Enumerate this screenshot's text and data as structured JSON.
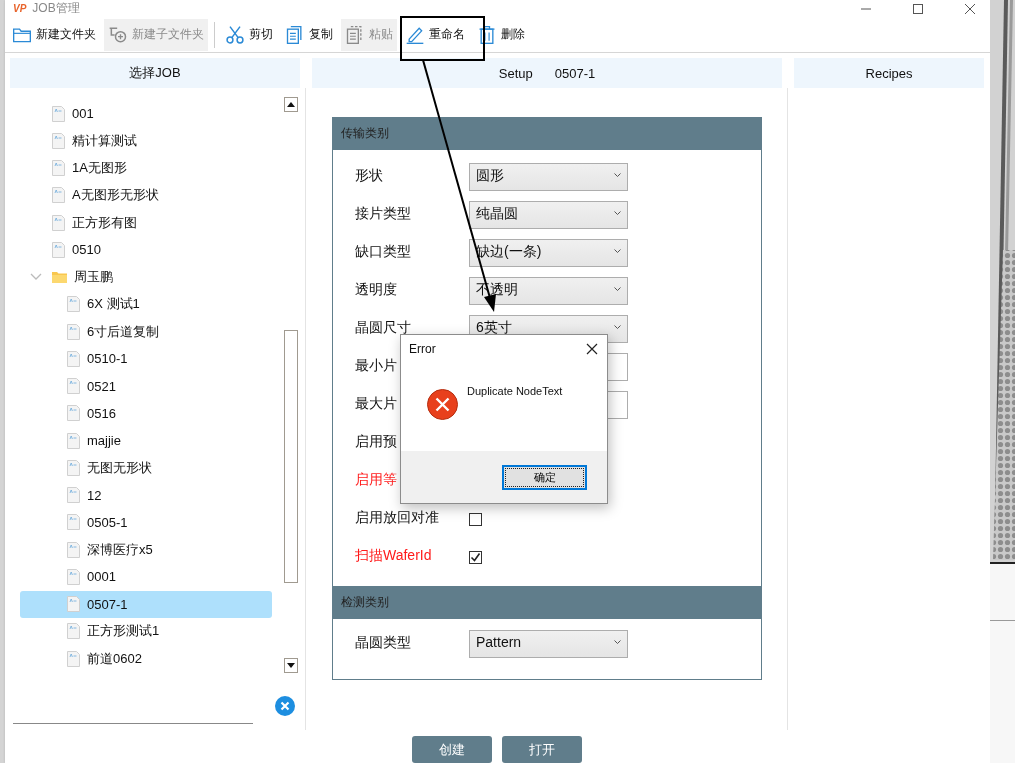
{
  "window": {
    "logo": "VP",
    "title": "JOB管理"
  },
  "toolbar": {
    "groups": [
      [
        {
          "label": "新建文件夹",
          "disabled": false
        },
        {
          "label": "新建子文件夹",
          "disabled": true
        }
      ],
      [
        {
          "label": "剪切",
          "disabled": false
        },
        {
          "label": "复制",
          "disabled": false
        },
        {
          "label": "粘贴",
          "disabled": true
        },
        {
          "label": "重命名",
          "disabled": false
        },
        {
          "label": "删除",
          "disabled": false
        }
      ]
    ]
  },
  "job_panel": {
    "header": "选择JOB",
    "tree": [
      {
        "label": "001",
        "kind": "file",
        "selected": false
      },
      {
        "label": "精计算测试",
        "kind": "file",
        "selected": false
      },
      {
        "label": "1A无图形",
        "kind": "file",
        "selected": false
      },
      {
        "label": "A无图形无形状",
        "kind": "file",
        "selected": false
      },
      {
        "label": "正方形有图",
        "kind": "file",
        "selected": false
      },
      {
        "label": "0510",
        "kind": "file",
        "selected": false
      },
      {
        "label": "周玉鹏",
        "kind": "folder",
        "selected": false,
        "expanded": true,
        "children": [
          {
            "label": "6X 测试1",
            "kind": "file",
            "selected": false
          },
          {
            "label": "6寸后道复制",
            "kind": "file",
            "selected": false
          },
          {
            "label": "0510-1",
            "kind": "file",
            "selected": false
          },
          {
            "label": "0521",
            "kind": "file",
            "selected": false
          },
          {
            "label": "0516",
            "kind": "file",
            "selected": false
          },
          {
            "label": "majjie",
            "kind": "file",
            "selected": false
          },
          {
            "label": "无图无形状",
            "kind": "file",
            "selected": false
          },
          {
            "label": "12",
            "kind": "file",
            "selected": false
          },
          {
            "label": "0505-1",
            "kind": "file",
            "selected": false
          },
          {
            "label": "深博医疗x5",
            "kind": "file",
            "selected": false
          },
          {
            "label": "0001",
            "kind": "file",
            "selected": false
          },
          {
            "label": "0507-1",
            "kind": "file",
            "selected": true
          },
          {
            "label": "正方形测试1",
            "kind": "file",
            "selected": false
          },
          {
            "label": "前道0602",
            "kind": "file",
            "selected": false
          }
        ]
      }
    ]
  },
  "setup_panel": {
    "header_label": "Setup",
    "header_value": "0507-1",
    "sections": [
      {
        "title": "传输类别",
        "rows": [
          {
            "label": "形状",
            "kind": "select",
            "value": "圆形",
            "highlighted": false
          },
          {
            "label": "接片类型",
            "kind": "select",
            "value": "纯晶圆",
            "highlighted": false
          },
          {
            "label": "缺口类型",
            "kind": "select",
            "value": "缺边(一条)",
            "highlighted": false
          },
          {
            "label": "透明度",
            "kind": "select",
            "value": "不透明",
            "highlighted": false
          },
          {
            "label": "晶圆尺寸",
            "kind": "select",
            "value": "6英寸",
            "highlighted": false
          },
          {
            "label": "最小片",
            "kind": "input",
            "highlighted": false
          },
          {
            "label": "最大片",
            "kind": "input",
            "highlighted": false
          },
          {
            "label": "启用预",
            "kind": "label",
            "highlighted": false
          },
          {
            "label": "启用等",
            "kind": "label",
            "highlighted": true
          },
          {
            "label": "启用放回对准",
            "kind": "checkbox",
            "checked": false,
            "highlighted": false
          },
          {
            "label": "扫描WaferId",
            "kind": "checkbox",
            "checked": true,
            "highlighted": true
          }
        ]
      },
      {
        "title": "检测类别",
        "rows": [
          {
            "label": "晶圆类型",
            "kind": "select",
            "value": "Pattern",
            "highlighted": false
          }
        ]
      }
    ]
  },
  "recipes_panel": {
    "header": "Recipes"
  },
  "dialog": {
    "title": "Error",
    "message": "Duplicate NodeText",
    "button": "确定"
  },
  "buttons": [
    "创建",
    "打开"
  ]
}
